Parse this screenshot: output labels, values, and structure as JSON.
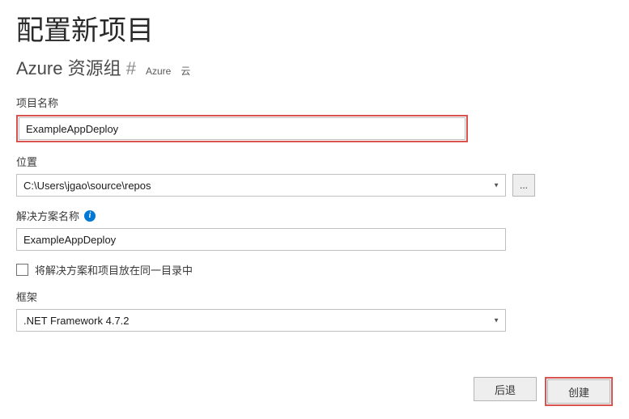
{
  "header": {
    "title": "配置新项目",
    "subtitle": "Azure 资源组",
    "subtitle_marker": "#",
    "tags": [
      "Azure",
      "云"
    ]
  },
  "fields": {
    "project_name": {
      "label": "项目名称",
      "value": "ExampleAppDeploy"
    },
    "location": {
      "label": "位置",
      "value": "C:\\Users\\jgao\\source\\repos",
      "browse_label": "..."
    },
    "solution_name": {
      "label": "解决方案名称",
      "value": "ExampleAppDeploy"
    },
    "same_dir": {
      "label": "将解决方案和项目放在同一目录中",
      "checked": false
    },
    "framework": {
      "label": "框架",
      "value": ".NET Framework 4.7.2"
    }
  },
  "footer": {
    "back_label": "后退",
    "create_label": "创建"
  }
}
